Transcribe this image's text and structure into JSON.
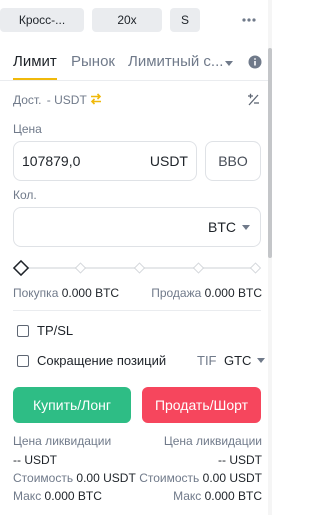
{
  "top": {
    "margin_mode": "Кросс-...",
    "leverage": "20x",
    "size_mode": "S"
  },
  "tabs": [
    {
      "label": "Лимит"
    },
    {
      "label": "Рынок"
    },
    {
      "label": "Лимитный с..."
    }
  ],
  "available": {
    "label": "Дост.",
    "value": "- USDT"
  },
  "price": {
    "label": "Цена",
    "value": "107879,0",
    "unit": "USDT",
    "bbo_label": "BBO"
  },
  "quantity": {
    "label": "Кол.",
    "value": "",
    "unit": "BTC"
  },
  "slider": {
    "level": 0
  },
  "max_info": {
    "buy_label": "Покупка",
    "buy_value": "0.000 BTC",
    "sell_label": "Продажа",
    "sell_value": "0.000 BTC"
  },
  "options": {
    "tpsl_label": "TP/SL",
    "reduce_label": "Сокращение позиций",
    "tif_label": "TIF",
    "tif_value": "GTC"
  },
  "buttons": {
    "buy": "Купить/Лонг",
    "sell": "Продать/Шорт"
  },
  "buy_summary": {
    "liq_label": "Цена ликвидации",
    "liq_value": "-- USDT",
    "cost_label": "Стоимость",
    "cost_value": "0.00 USDT",
    "max_label": "Макс",
    "max_value": "0.000 BTC"
  },
  "sell_summary": {
    "liq_label": "Цена ликвидации",
    "liq_value": "-- USDT",
    "cost_label": "Стоимость",
    "cost_value": "0.00 USDT",
    "max_label": "Макс",
    "max_value": "0.000 BTC"
  },
  "colors": {
    "accent": "#f0b90b",
    "buy": "#2ebd85",
    "sell": "#f6465d"
  }
}
